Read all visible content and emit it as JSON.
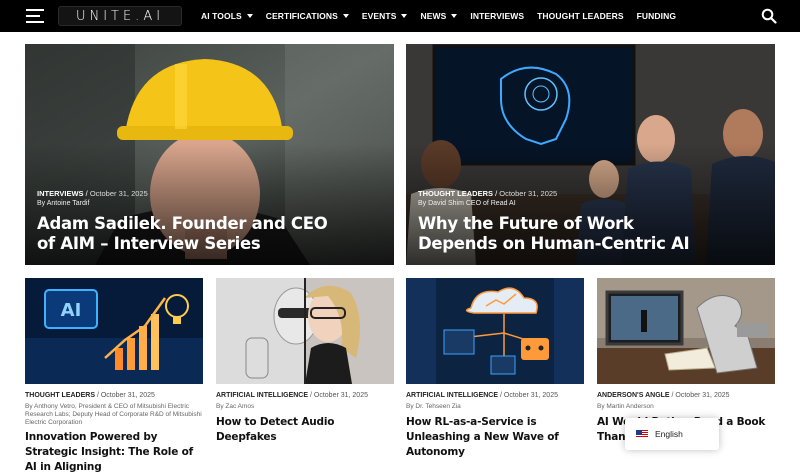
{
  "header": {
    "logo_text": "UNITE.AI",
    "nav": [
      {
        "label": "AI TOOLS",
        "has_dropdown": true
      },
      {
        "label": "CERTIFICATIONS",
        "has_dropdown": true
      },
      {
        "label": "EVENTS",
        "has_dropdown": true
      },
      {
        "label": "NEWS",
        "has_dropdown": true
      },
      {
        "label": "INTERVIEWS",
        "has_dropdown": false
      },
      {
        "label": "THOUGHT LEADERS",
        "has_dropdown": false
      },
      {
        "label": "FUNDING",
        "has_dropdown": false
      }
    ],
    "icons": {
      "menu": "hamburger-icon",
      "search": "search-icon"
    }
  },
  "featured": [
    {
      "category": "INTERVIEWS",
      "date": "October 31, 2025",
      "author": "By Antoine Tardif",
      "title": "Adam Sadilek. Founder and CEO of AIM – Interview Series"
    },
    {
      "category": "THOUGHT LEADERS",
      "date": "October 31, 2025",
      "author": "By David Shim CEO of Read AI",
      "title": "Why the Future of Work Depends on Human-Centric AI"
    }
  ],
  "articles": [
    {
      "category": "THOUGHT LEADERS",
      "date": "October 31, 2025",
      "author": "By Anthony Vetro, President & CEO of Mitsubishi Electric Research Labs; Deputy Head of Corporate R&D of Mitsubishi Electric Corporation",
      "title": "Innovation Powered by Strategic Insight: The Role of AI in Aligning"
    },
    {
      "category": "ARTIFICIAL INTELLIGENCE",
      "date": "October 31, 2025",
      "author": "By Zac Amos",
      "title": "How to Detect Audio Deepfakes"
    },
    {
      "category": "ARTIFICIAL INTELLIGENCE",
      "date": "October 31, 2025",
      "author": "By Dr. Tehseen Zia",
      "title": "How RL-as-a-Service is Unleashing a New Wave of Autonomy"
    },
    {
      "category": "ANDERSON'S ANGLE",
      "date": "October 31, 2025",
      "author": "By Martin Anderson",
      "title": "AI Would Rather Read a Book Than Watch"
    }
  ],
  "art": {
    "ai_badge_text": "AI"
  },
  "language_popup": {
    "label": "English",
    "flag": "us-flag-icon"
  },
  "colors": {
    "topbar": "#000000",
    "accent_blue": "#2e7bd6"
  }
}
